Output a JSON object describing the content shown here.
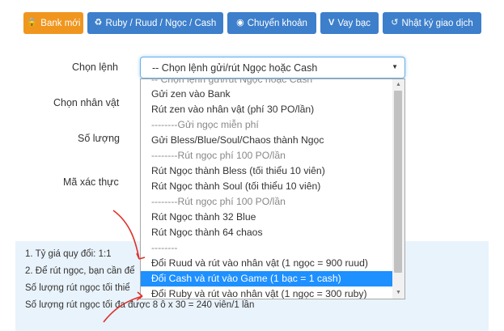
{
  "tabs": [
    {
      "label": "Bank mới",
      "icon": "lock-icon"
    },
    {
      "label": "Ruby / Ruud / Ngọc / Cash",
      "icon": "recycle-icon"
    },
    {
      "label": "Chuyển khoản",
      "icon": "eye-icon"
    },
    {
      "label": "Vay bạc",
      "icon": "vimeo-icon"
    },
    {
      "label": "Nhật ký giao dịch",
      "icon": "history-icon"
    }
  ],
  "form": {
    "command_label": "Chọn lệnh",
    "character_label": "Chọn nhân vật",
    "quantity_label": "Số lượng",
    "captcha_label": "Mã xác thực",
    "command_selected": "-- Chọn lệnh gửi/rút Ngọc hoặc Cash"
  },
  "dropdown": {
    "partial_top": "-- Chọn lệnh gửi/rút Ngọc hoặc Cash",
    "options": [
      "Gửi zen vào Bank",
      "Rút zen vào nhân vật (phí 30 PO/lần)",
      "--------Gửi ngọc miễn phí",
      "Gửi Bless/Blue/Soul/Chaos thành Ngọc",
      "--------Rút ngọc phí 100 PO/lần",
      "Rút Ngọc thành Bless (tối thiểu 10 viên)",
      "Rút Ngọc thành Soul (tối thiểu 10 viên)",
      "--------Rút ngọc phí 100 PO/lần",
      "Rút Ngọc thành 32 Blue",
      "Rút Ngọc thành 64 chaos",
      "--------",
      "Đổi Ruud và rút vào nhân vật (1 ngọc = 900 ruud)",
      "Đổi Cash và rút vào Game (1 bạc = 1 cash)",
      "Đổi Ruby và rút vào nhân vật (1 ngọc = 300 ruby)"
    ],
    "selected_index": 12
  },
  "info": {
    "lines": [
      "1. Tỷ giá quy đổi: 1:1",
      "2. Để rút ngọc, bạn cần để",
      "Số lượng rút ngọc tối thiể",
      "Số lượng rút ngọc tối đa được 8 ô x 30 = 240 viên/1 lần"
    ]
  },
  "colors": {
    "orange": "#f0961e",
    "blue": "#3d7fcb",
    "highlight": "#1e90ff",
    "annotation": "#e0302a"
  }
}
